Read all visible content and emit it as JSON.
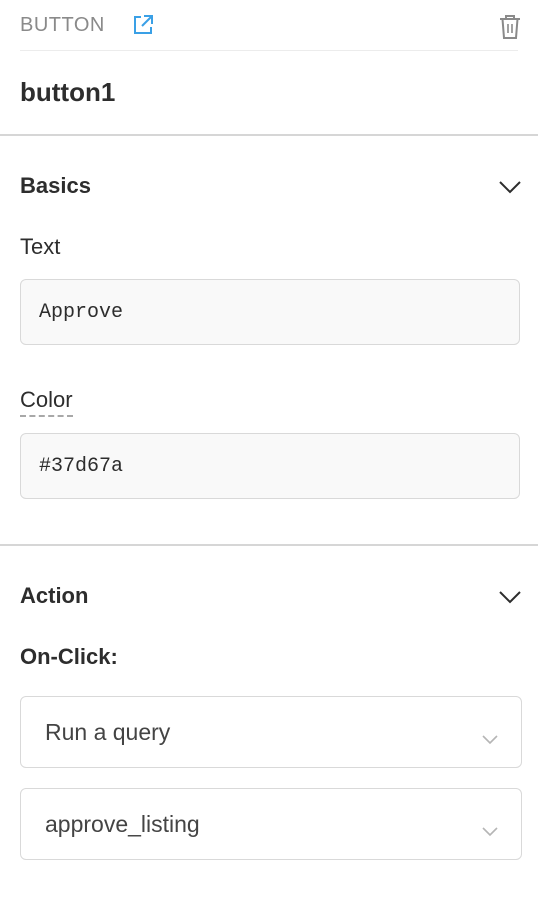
{
  "header": {
    "type_label": "BUTTON",
    "external_icon": "external-link-icon",
    "trash_icon": "trash-icon"
  },
  "component": {
    "name": "button1"
  },
  "basics": {
    "title": "Basics",
    "text_label": "Text",
    "text_value": "Approve",
    "color_label": "Color",
    "color_value": "#37d67a"
  },
  "action": {
    "title": "Action",
    "onclick_label": "On-Click:",
    "action_select": "Run a query",
    "query_select": "approve_listing"
  },
  "colors": {
    "accent": "#3aa0e6",
    "divider": "#d6d6d6",
    "muted_text": "#8a8a8a"
  }
}
